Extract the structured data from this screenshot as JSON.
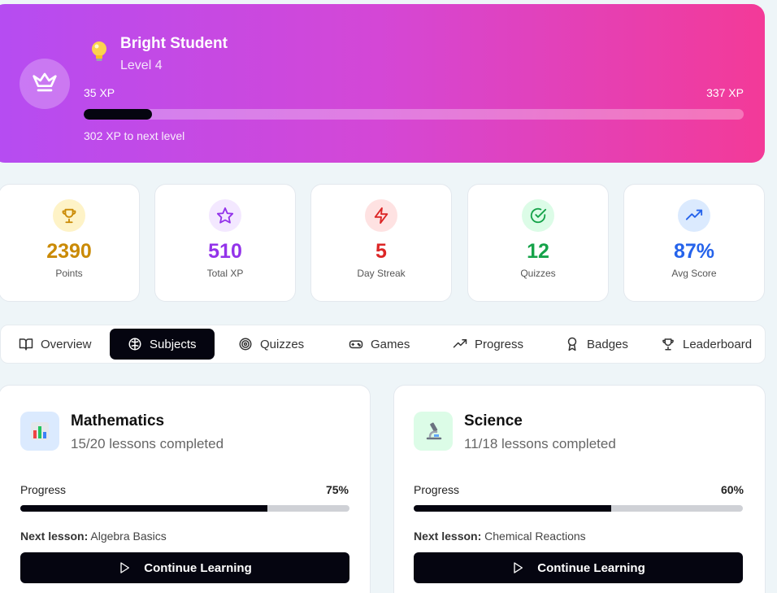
{
  "profile": {
    "name": "Bright Student",
    "level": "Level 4",
    "xp_current_label": "35 XP",
    "xp_target_label": "337 XP",
    "xp_progress_fraction": 0.104,
    "xp_to_next": "302 XP to next level"
  },
  "stats": [
    {
      "value": "2390",
      "label": "Points",
      "icon": "trophy-icon",
      "color": "#ca8a04",
      "bg": "#fef3c7"
    },
    {
      "value": "510",
      "label": "Total XP",
      "icon": "star-icon",
      "color": "#9333ea",
      "bg": "#f3e8ff"
    },
    {
      "value": "5",
      "label": "Day Streak",
      "icon": "zap-icon",
      "color": "#dc2626",
      "bg": "#fee2e2"
    },
    {
      "value": "12",
      "label": "Quizzes",
      "icon": "check-circle-icon",
      "color": "#16a34a",
      "bg": "#dcfce7"
    },
    {
      "value": "87%",
      "label": "Avg Score",
      "icon": "trending-up-icon",
      "color": "#2563eb",
      "bg": "#dbeafe"
    }
  ],
  "tabs": [
    {
      "label": "Overview",
      "icon": "book-open-icon",
      "active": false
    },
    {
      "label": "Subjects",
      "icon": "brain-icon",
      "active": true
    },
    {
      "label": "Quizzes",
      "icon": "target-icon",
      "active": false
    },
    {
      "label": "Games",
      "icon": "gamepad-icon",
      "active": false
    },
    {
      "label": "Progress",
      "icon": "trending-up-icon",
      "active": false
    },
    {
      "label": "Badges",
      "icon": "award-icon",
      "active": false
    },
    {
      "label": "Leaderboard",
      "icon": "trophy-icon",
      "active": false
    }
  ],
  "subjects": [
    {
      "title": "Mathematics",
      "subtitle": "15/20 lessons completed",
      "progress_label": "Progress",
      "percent_label": "75%",
      "progress_fraction": 0.75,
      "next_label": "Next lesson:",
      "next_lesson": "Algebra Basics",
      "button_label": "Continue Learning",
      "icon": "bar-chart-icon",
      "icon_bg": "#dbeafe"
    },
    {
      "title": "Science",
      "subtitle": "11/18 lessons completed",
      "progress_label": "Progress",
      "percent_label": "60%",
      "progress_fraction": 0.6,
      "next_label": "Next lesson:",
      "next_lesson": "Chemical Reactions",
      "button_label": "Continue Learning",
      "icon": "microscope-icon",
      "icon_bg": "#dcfce7"
    }
  ]
}
